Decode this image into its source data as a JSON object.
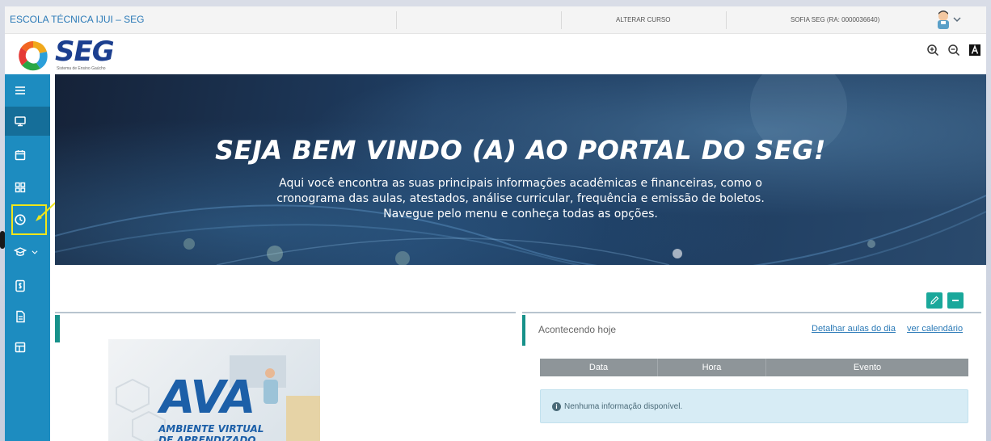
{
  "topbar": {
    "school": "ESCOLA TÉCNICA IJUI – SEG",
    "change_course": "ALTERAR CURSO",
    "user": "SOFIA SEG (RA: 0000036640)"
  },
  "logo": {
    "name": "SEG",
    "subtitle": "Sistema de Ensino Gaúcho"
  },
  "tools": [
    "zoom-in-icon",
    "zoom-out-icon",
    "contrast-icon"
  ],
  "sidebar": {
    "items": [
      {
        "icon": "menu-icon"
      },
      {
        "icon": "monitor-icon"
      },
      {
        "icon": "calendar-icon"
      },
      {
        "icon": "grid-icon"
      },
      {
        "icon": "clock-icon"
      },
      {
        "icon": "graduation-cap-icon"
      },
      {
        "icon": "document-money-icon"
      },
      {
        "icon": "file-icon"
      },
      {
        "icon": "layout-icon"
      }
    ]
  },
  "banner": {
    "title": "SEJA BEM VINDO (A) AO PORTAL DO SEG!",
    "line1": "Aqui você encontra as suas principais informações acadêmicas e financeiras, como o",
    "line2": "cronograma das aulas, atestados, análise curricular, frequência e emissão de boletos.",
    "line3": "Navegue pelo menu e conheça todas as opções."
  },
  "ava": {
    "title": "AVA",
    "sub1": "AMBIENTE VIRTUAL",
    "sub2": "DE APRENDIZADO"
  },
  "events": {
    "title": "Acontecendo hoje",
    "link_details": "Detalhar aulas do dia",
    "link_calendar": "ver calendário",
    "columns": [
      "Data",
      "Hora",
      "Evento"
    ],
    "empty": "Nenhuma informação disponível."
  },
  "colors": {
    "sidebar": "#1d8cc0",
    "accent": "#17918a",
    "link": "#2b7ab7",
    "highlight": "#f0e61a"
  }
}
